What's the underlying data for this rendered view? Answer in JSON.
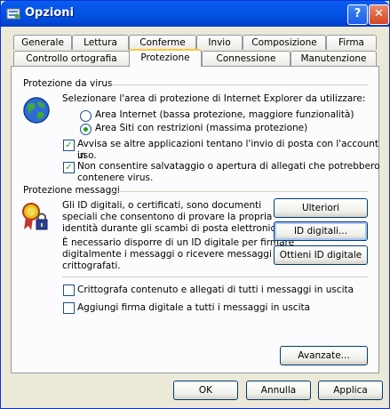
{
  "window": {
    "title": "Opzioni"
  },
  "tabs": {
    "row1": [
      "Generale",
      "Lettura",
      "Conferme",
      "Invio",
      "Composizione",
      "Firma"
    ],
    "row2": [
      "Controllo ortografia",
      "Protezione",
      "Connessione",
      "Manutenzione"
    ],
    "active": "Protezione"
  },
  "virus": {
    "group_label": "Protezione da virus",
    "intro": "Selezionare l'area di protezione di Internet Explorer da utilizzare:",
    "radio_internet": "Area Internet (bassa protezione, maggiore funzionalità)",
    "radio_restricted": "Area Siti con restrizioni (massima protezione)",
    "selected_zone": "Area Siti con restrizioni",
    "check_warn_line1": "Avvisa se altre applicazioni tentano l'invio di posta con l'account in",
    "check_warn_line2": "uso.",
    "check_attach_line1": "Non consentire salvataggio o apertura di allegati che potrebbero",
    "check_attach_line2": "contenere virus.",
    "check_warn_checked": true,
    "check_attach_checked": true
  },
  "secure": {
    "group_label": "Protezione messaggi",
    "desc1_line1": "Gli ID digitali, o certificati, sono documenti",
    "desc1_line2": "speciali che consentono di provare la propria",
    "desc1_line3": "identità durante gli scambi di posta elettronica.",
    "desc2_line1": "È necessario disporre di un ID digitale per firmare",
    "desc2_line2": "digitalmente i messaggi o ricevere messaggi",
    "desc2_line3": "crittografati.",
    "btn_more": "Ulteriori informazioni...",
    "btn_ids": "ID digitali...",
    "btn_get": "Ottieni ID digitale",
    "check_encrypt": "Crittografa contenuto e allegati di tutti i messaggi in uscita",
    "check_sign": "Aggiungi firma digitale a tutti i messaggi in uscita",
    "check_encrypt_checked": false,
    "check_sign_checked": false
  },
  "buttons": {
    "advanced": "Avanzate...",
    "ok": "OK",
    "cancel": "Annulla",
    "apply": "Applica"
  },
  "colors": {
    "titlebar": "#0453E4",
    "face": "#ECE9D8",
    "active_tab_accent": "#FFC83C",
    "check_mark": "#21A121"
  }
}
